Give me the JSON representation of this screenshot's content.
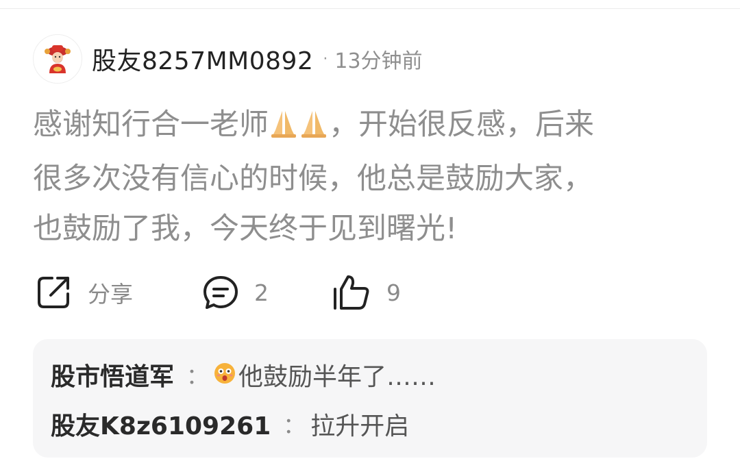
{
  "post": {
    "username": "股友8257MM0892",
    "separator": "·",
    "time": "13分钟前",
    "content_line1_a": "感谢知行合一老师",
    "content_line1_b": "，开始很反感，后来",
    "content_line2": "很多次没有信心的时候，他总是鼓励大家，",
    "content_line3": "也鼓励了我，今天终于见到曙光!",
    "emoji_icons": [
      "folded-hands-icon",
      "folded-hands-icon"
    ]
  },
  "actions": {
    "share_label": "分享",
    "comment_count": "2",
    "like_count": "9",
    "icons": [
      "share-icon",
      "comment-icon",
      "thumbs-up-icon"
    ]
  },
  "comments": [
    {
      "author": "股市悟道军",
      "sep": "：",
      "text": "他鼓励半年了……",
      "emoji": "astonished-face-icon"
    },
    {
      "author": "股友K8z6109261",
      "sep": "：",
      "text": "拉升开启"
    }
  ],
  "colors": {
    "text_primary": "#222222",
    "text_muted": "#8e8e8e",
    "comment_bg": "#f6f6f7",
    "avatar_accent": "#d9342b"
  }
}
